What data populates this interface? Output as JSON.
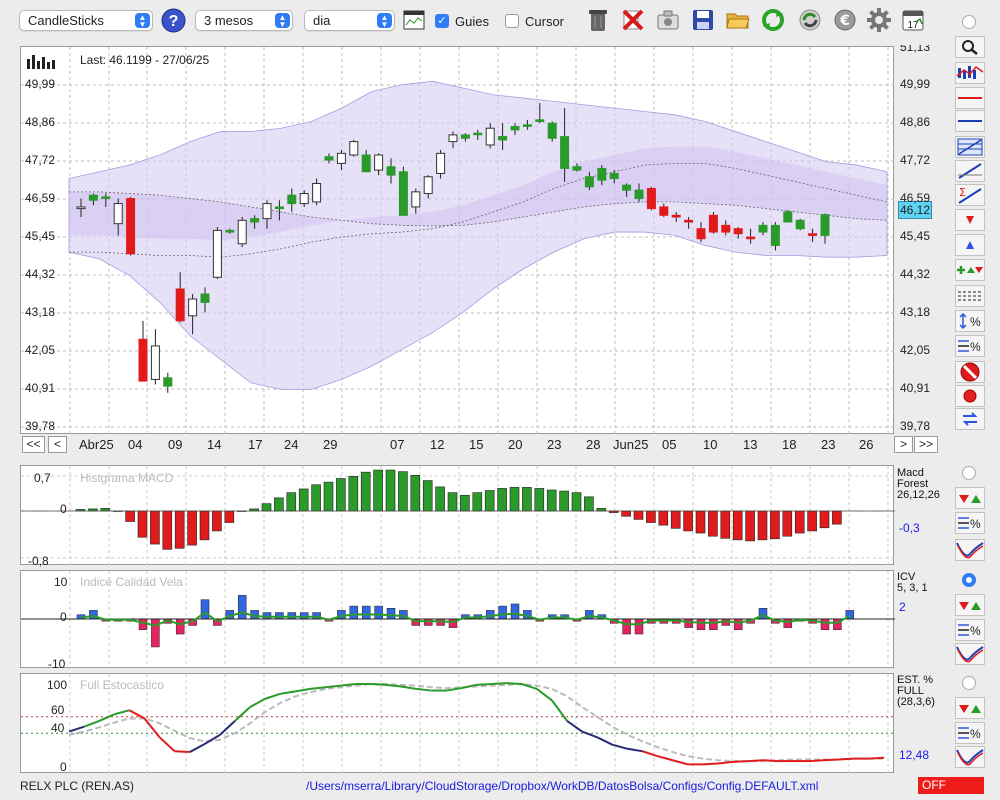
{
  "toolbar": {
    "chart_type": "CandleSticks",
    "period": "3 mesos",
    "interval": "dia",
    "guides_label": "Guies",
    "guides_checked": true,
    "cursor_label": "Cursor",
    "cursor_checked": false,
    "icons": [
      "help-icon",
      "chart-view-icon",
      "trash-icon",
      "delete-icon",
      "camera-icon",
      "save-icon",
      "open-folder-icon",
      "refresh-icon",
      "convert-icon",
      "euro-icon",
      "settings-gear-icon",
      "calendar-icon"
    ],
    "calendar_day": "17"
  },
  "main_chart": {
    "last_label": "Last: 46.1199 - 27/06/25",
    "price_labels": [
      "49,99",
      "48,86",
      "47,72",
      "46,59",
      "45,45",
      "44,32",
      "43,18",
      "42,05",
      "40,91",
      "39,78"
    ],
    "top_cut_label": "51,13",
    "current_price": "46,12",
    "nav_left": [
      "<<",
      "<"
    ],
    "nav_right": [
      ">",
      ">>"
    ],
    "x_labels": [
      "Abr25",
      "04",
      "09",
      "14",
      "17",
      "24",
      "29",
      "07",
      "12",
      "15",
      "20",
      "23",
      "28",
      "Jun25",
      "05",
      "10",
      "13",
      "18",
      "23",
      "26"
    ]
  },
  "chart_data": {
    "type": "candlestick",
    "ylim": [
      39.78,
      51.13
    ],
    "candles": [
      {
        "o": 46.3,
        "h": 46.6,
        "l": 46.05,
        "c": 46.35,
        "up": true
      },
      {
        "o": 46.55,
        "h": 46.75,
        "l": 46.4,
        "c": 46.7,
        "up": true
      },
      {
        "o": 46.6,
        "h": 46.75,
        "l": 46.35,
        "c": 46.65,
        "up": true
      },
      {
        "o": 45.85,
        "h": 46.6,
        "l": 45.5,
        "c": 46.45,
        "up": true
      },
      {
        "o": 46.6,
        "h": 46.65,
        "l": 44.9,
        "c": 44.95,
        "up": false
      },
      {
        "o": 42.4,
        "h": 42.95,
        "l": 41.15,
        "c": 41.15,
        "up": false
      },
      {
        "o": 41.2,
        "h": 42.7,
        "l": 41.05,
        "c": 42.2,
        "up": true
      },
      {
        "o": 41.0,
        "h": 41.4,
        "l": 40.8,
        "c": 41.25,
        "up": true
      },
      {
        "o": 43.9,
        "h": 44.4,
        "l": 42.9,
        "c": 42.95,
        "up": false
      },
      {
        "o": 43.1,
        "h": 43.75,
        "l": 42.55,
        "c": 43.6,
        "up": true
      },
      {
        "o": 43.5,
        "h": 43.95,
        "l": 43.2,
        "c": 43.75,
        "up": true
      },
      {
        "o": 44.25,
        "h": 45.75,
        "l": 44.2,
        "c": 45.65,
        "up": true
      },
      {
        "o": 45.65,
        "h": 45.7,
        "l": 45.55,
        "c": 45.6,
        "up": true
      },
      {
        "o": 45.25,
        "h": 46.05,
        "l": 45.15,
        "c": 45.95,
        "up": true
      },
      {
        "o": 45.9,
        "h": 46.1,
        "l": 45.7,
        "c": 46.0,
        "up": true
      },
      {
        "o": 46.0,
        "h": 46.55,
        "l": 45.7,
        "c": 46.45,
        "up": true
      },
      {
        "o": 46.3,
        "h": 46.55,
        "l": 45.95,
        "c": 46.35,
        "up": true
      },
      {
        "o": 46.45,
        "h": 46.9,
        "l": 46.2,
        "c": 46.7,
        "up": true
      },
      {
        "o": 46.45,
        "h": 46.85,
        "l": 46.35,
        "c": 46.75,
        "up": true
      },
      {
        "o": 46.5,
        "h": 47.2,
        "l": 46.4,
        "c": 47.05,
        "up": true
      },
      {
        "o": 47.85,
        "h": 47.95,
        "l": 47.65,
        "c": 47.75,
        "up": true
      },
      {
        "o": 47.65,
        "h": 48.05,
        "l": 47.45,
        "c": 47.95,
        "up": true
      },
      {
        "o": 47.9,
        "h": 48.35,
        "l": 47.85,
        "c": 48.3,
        "up": true
      },
      {
        "o": 47.9,
        "h": 48.05,
        "l": 47.4,
        "c": 47.4,
        "up": true
      },
      {
        "o": 47.45,
        "h": 47.95,
        "l": 47.3,
        "c": 47.9,
        "up": true
      },
      {
        "o": 47.55,
        "h": 47.8,
        "l": 47.05,
        "c": 47.3,
        "up": true
      },
      {
        "o": 47.4,
        "h": 47.55,
        "l": 46.1,
        "c": 46.1,
        "up": true
      },
      {
        "o": 46.35,
        "h": 46.9,
        "l": 46.15,
        "c": 46.8,
        "up": true
      },
      {
        "o": 46.75,
        "h": 47.3,
        "l": 46.6,
        "c": 47.25,
        "up": true
      },
      {
        "o": 47.35,
        "h": 48.05,
        "l": 47.2,
        "c": 47.95,
        "up": true
      },
      {
        "o": 48.3,
        "h": 48.6,
        "l": 48.1,
        "c": 48.5,
        "up": true
      },
      {
        "o": 48.4,
        "h": 48.55,
        "l": 48.3,
        "c": 48.5,
        "up": true
      },
      {
        "o": 48.55,
        "h": 48.65,
        "l": 48.35,
        "c": 48.55,
        "up": true
      },
      {
        "o": 48.2,
        "h": 48.85,
        "l": 48.1,
        "c": 48.7,
        "up": true
      },
      {
        "o": 48.35,
        "h": 48.85,
        "l": 48.05,
        "c": 48.45,
        "up": true
      },
      {
        "o": 48.75,
        "h": 48.85,
        "l": 48.5,
        "c": 48.65,
        "up": true
      },
      {
        "o": 48.8,
        "h": 48.95,
        "l": 48.65,
        "c": 48.8,
        "up": true
      },
      {
        "o": 48.9,
        "h": 49.45,
        "l": 48.85,
        "c": 48.95,
        "up": true
      },
      {
        "o": 48.85,
        "h": 48.9,
        "l": 48.3,
        "c": 48.4,
        "up": true
      },
      {
        "o": 48.45,
        "h": 49.3,
        "l": 47.1,
        "c": 47.5,
        "up": true
      },
      {
        "o": 47.55,
        "h": 47.65,
        "l": 47.4,
        "c": 47.45,
        "up": true
      },
      {
        "o": 46.95,
        "h": 47.4,
        "l": 46.85,
        "c": 47.25,
        "up": true
      },
      {
        "o": 47.5,
        "h": 47.6,
        "l": 47.0,
        "c": 47.15,
        "up": true
      },
      {
        "o": 47.2,
        "h": 47.45,
        "l": 47.05,
        "c": 47.35,
        "up": true
      },
      {
        "o": 46.85,
        "h": 47.05,
        "l": 46.65,
        "c": 47.0,
        "up": true
      },
      {
        "o": 46.85,
        "h": 47.05,
        "l": 46.5,
        "c": 46.6,
        "up": true
      },
      {
        "o": 46.9,
        "h": 46.95,
        "l": 46.25,
        "c": 46.3,
        "up": false
      },
      {
        "o": 46.35,
        "h": 46.45,
        "l": 46.05,
        "c": 46.1,
        "up": false
      },
      {
        "o": 46.1,
        "h": 46.2,
        "l": 45.9,
        "c": 46.05,
        "up": false
      },
      {
        "o": 45.95,
        "h": 46.05,
        "l": 45.7,
        "c": 45.9,
        "up": false
      },
      {
        "o": 45.7,
        "h": 45.9,
        "l": 45.3,
        "c": 45.4,
        "up": false
      },
      {
        "o": 46.1,
        "h": 46.2,
        "l": 45.55,
        "c": 45.6,
        "up": false
      },
      {
        "o": 45.8,
        "h": 45.95,
        "l": 45.5,
        "c": 45.6,
        "up": false
      },
      {
        "o": 45.7,
        "h": 45.75,
        "l": 45.4,
        "c": 45.55,
        "up": false
      },
      {
        "o": 45.45,
        "h": 45.7,
        "l": 45.25,
        "c": 45.4,
        "up": false
      },
      {
        "o": 45.6,
        "h": 45.9,
        "l": 45.5,
        "c": 45.8,
        "up": true
      },
      {
        "o": 45.2,
        "h": 45.9,
        "l": 45.05,
        "c": 45.8,
        "up": true
      },
      {
        "o": 45.9,
        "h": 46.25,
        "l": 45.9,
        "c": 46.2,
        "up": true
      },
      {
        "o": 45.7,
        "h": 46.0,
        "l": 45.65,
        "c": 45.95,
        "up": true
      },
      {
        "o": 45.55,
        "h": 45.7,
        "l": 45.3,
        "c": 45.5,
        "up": false
      },
      {
        "o": 45.5,
        "h": 46.15,
        "l": 45.25,
        "c": 46.12,
        "up": true
      }
    ],
    "bollinger_upper": [
      47.2,
      47.4,
      47.6,
      47.9,
      48.3,
      48.6,
      48.6,
      48.7,
      48.9,
      49.3,
      49.8,
      50.0,
      50.1,
      49.9,
      49.7,
      49.6,
      49.5,
      49.4,
      49.3,
      49.2,
      49.1,
      48.9,
      48.6,
      48.3,
      48.0,
      47.7,
      47.6,
      47.4
    ],
    "bollinger_lower": [
      45.0,
      44.8,
      44.3,
      43.5,
      42.5,
      41.8,
      41.1,
      40.9,
      40.9,
      41.2,
      41.6,
      42.1,
      42.6,
      43.2,
      43.9,
      44.5,
      45.0,
      45.4,
      45.6,
      45.6,
      45.5,
      45.2,
      45.0,
      44.9,
      44.9,
      44.85,
      44.85,
      44.9
    ],
    "ema": [
      45.0,
      45.0,
      44.95,
      44.9,
      44.9,
      44.85,
      44.95,
      45.1,
      45.3,
      45.45,
      45.55,
      45.6,
      45.7,
      45.9,
      46.2,
      46.5,
      46.9,
      47.2,
      47.4,
      47.6,
      47.65,
      47.65,
      47.5,
      47.3,
      47.1,
      46.9,
      46.7,
      46.5
    ],
    "ema2": [
      46.8,
      46.8,
      46.75,
      46.7,
      46.6,
      46.5,
      46.35,
      46.2,
      46.05,
      45.95,
      45.85,
      45.8,
      45.78,
      45.8,
      45.9,
      46.05,
      46.2,
      46.35,
      46.45,
      46.5,
      46.5,
      46.45,
      46.4,
      46.3,
      46.2,
      46.1,
      46.0,
      45.95
    ]
  },
  "macd_panel": {
    "title": "Histgrama MACD",
    "axis": [
      "0,7",
      "0",
      "-0,8"
    ],
    "side_label_1": "Macd",
    "side_label_2": "Forest",
    "side_label_3": "26,12,26",
    "value": "-0,3",
    "bars": [
      0.03,
      0.04,
      0.05,
      0,
      -0.2,
      -0.5,
      -0.63,
      -0.73,
      -0.71,
      -0.65,
      -0.55,
      -0.38,
      -0.22,
      0,
      0.04,
      0.14,
      0.25,
      0.35,
      0.42,
      0.5,
      0.55,
      0.62,
      0.66,
      0.74,
      0.78,
      0.78,
      0.75,
      0.68,
      0.58,
      0.46,
      0.35,
      0.3,
      0.35,
      0.39,
      0.43,
      0.45,
      0.45,
      0.43,
      0.4,
      0.38,
      0.35,
      0.27,
      0.05,
      -0.03,
      -0.1,
      -0.16,
      -0.22,
      -0.27,
      -0.33,
      -0.38,
      -0.42,
      -0.48,
      -0.52,
      -0.55,
      -0.57,
      -0.55,
      -0.53,
      -0.48,
      -0.42,
      -0.38,
      -0.32,
      -0.25
    ]
  },
  "icv_panel": {
    "title": "Indice Calidad Vela",
    "axis": [
      "10",
      "0",
      "-10"
    ],
    "side_label_1": "ICV",
    "side_label_2": "5, 3, 1",
    "value": "2",
    "bars": [
      1,
      2,
      -0.5,
      -0.5,
      -0.5,
      -2.5,
      -6.5,
      -1,
      -3.5,
      -1.5,
      4.5,
      -1.5,
      2,
      5.5,
      2,
      1.5,
      1.5,
      1.5,
      1.5,
      1.5,
      -0.5,
      2,
      3,
      3,
      3,
      2.5,
      2,
      -1.5,
      -1.5,
      -1.5,
      -2,
      1,
      1,
      2,
      3,
      3.5,
      2,
      -0.5,
      1,
      1,
      -0.5,
      2,
      1,
      -1,
      -3.5,
      -3.5,
      -1,
      -1,
      -1,
      -2,
      -2.5,
      -2.5,
      -1.5,
      -2.5,
      -1,
      2.5,
      -1,
      -2,
      -0.5,
      -1,
      -2.5,
      -2.5,
      2
    ]
  },
  "stoch_panel": {
    "title": "Full Estocastico",
    "axis": [
      "100",
      "60",
      "40",
      "0"
    ],
    "side_label_1": "EST. %",
    "side_label_2": "FULL",
    "side_label_3": "(28,3,6)",
    "value": "12,48",
    "k": [
      42,
      48,
      55,
      63,
      68,
      58,
      35,
      18,
      17,
      27,
      38,
      55,
      72,
      82,
      88,
      91,
      94,
      96,
      98,
      100,
      100,
      99,
      97,
      94,
      92,
      92,
      95,
      99,
      100,
      101,
      100,
      94,
      80,
      55,
      42,
      35,
      26,
      21,
      18,
      12,
      7,
      2,
      2,
      3,
      5,
      6,
      7,
      6,
      6,
      6,
      7,
      8,
      9,
      9,
      10
    ],
    "d": [
      38,
      42,
      47,
      53,
      58,
      58,
      52,
      43,
      34,
      30,
      32,
      40,
      52,
      66,
      77,
      85,
      90,
      94,
      96,
      98,
      100,
      100,
      99,
      98,
      96,
      95,
      96,
      97,
      98,
      99,
      100,
      98,
      94,
      85,
      72,
      60,
      48,
      38,
      30,
      23,
      17,
      12,
      9,
      7,
      6,
      6,
      6,
      7,
      8,
      8,
      8,
      8,
      9,
      9,
      9
    ]
  },
  "status_bar": {
    "symbol": "RELX PLC (REN.AS)",
    "config_path": "/Users/mserra/Library/CloudStorage/Dropbox/WorkDB/DatosBolsa/Configs/Config.DEFAULT.xml",
    "toggle_label": "OFF"
  },
  "right_toolbar": [
    "zoom-icon",
    "candle-pattern-icon",
    "horizontal-red-line-icon",
    "horizontal-blue-line-icon",
    "fibonacci-icon",
    "trend-line-icon",
    "sigma-regression-icon",
    "arrow-down-red-icon",
    "arrow-up-blue-icon",
    "add-signals-icon",
    "dashed-lines-icon",
    "percent-scale-icon",
    "percent-lines-icon",
    "stop-icon",
    "record-icon",
    "swap-icon"
  ],
  "colors": {
    "up": "#2a9a2a",
    "down": "#e11b1b",
    "band": "#d7cdf4",
    "macd_pos": "#2a9a2a",
    "macd_neg": "#e11b1b",
    "icv_pos": "#3166e0",
    "icv_neg": "#e4245f",
    "accent": "#2f7cf6",
    "off": "#ef1c1c",
    "price_tag": "#5ed4f2"
  }
}
